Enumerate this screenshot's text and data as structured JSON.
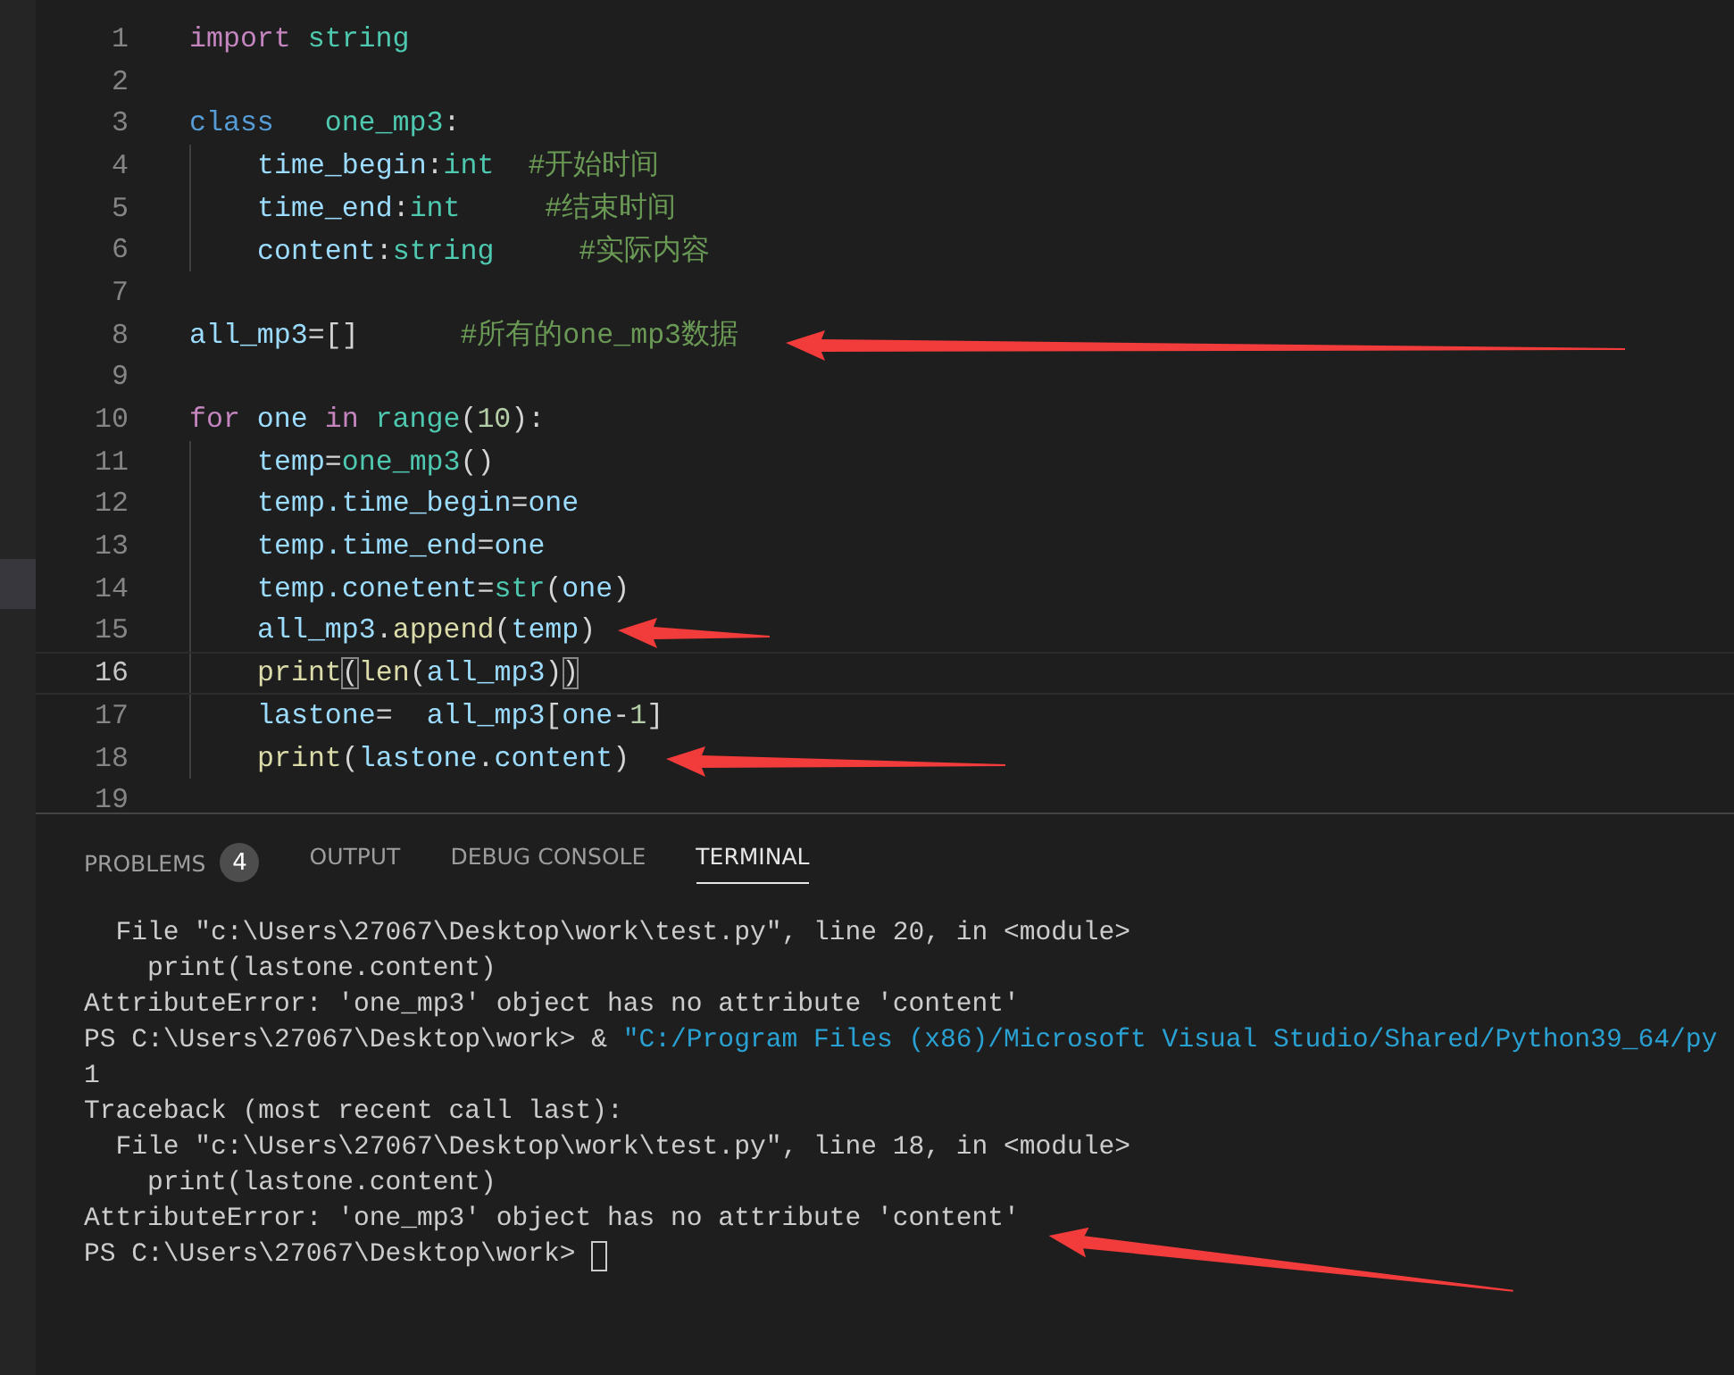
{
  "editor": {
    "lines": [
      {
        "number": "1",
        "current": false,
        "indented": false,
        "tokens": [
          {
            "kind": "keyword",
            "text": "import"
          },
          {
            "kind": "type",
            "text": " string"
          }
        ]
      },
      {
        "number": "2",
        "current": false,
        "indented": false
      },
      {
        "number": "3",
        "current": false,
        "indented": false,
        "tokens": [
          {
            "kind": "storage",
            "text": "class"
          },
          {
            "kind": "type",
            "text": "   one_mp3"
          },
          {
            "kind": "plain",
            "text": ":"
          }
        ]
      },
      {
        "number": "4",
        "current": false,
        "indented": true,
        "tokens": [
          {
            "kind": "variable",
            "text": "time_begin"
          },
          {
            "kind": "plain",
            "text": ":"
          },
          {
            "kind": "type",
            "text": "int"
          },
          {
            "kind": "comment",
            "text": "  #开始时间"
          }
        ]
      },
      {
        "number": "5",
        "current": false,
        "indented": true,
        "tokens": [
          {
            "kind": "variable",
            "text": "time_end"
          },
          {
            "kind": "plain",
            "text": ":"
          },
          {
            "kind": "type",
            "text": "int"
          },
          {
            "kind": "comment",
            "text": "     #结束时间"
          }
        ]
      },
      {
        "number": "6",
        "current": false,
        "indented": true,
        "tokens": [
          {
            "kind": "variable",
            "text": "content"
          },
          {
            "kind": "plain",
            "text": ":"
          },
          {
            "kind": "type",
            "text": "string"
          },
          {
            "kind": "comment",
            "text": "     #实际内容"
          }
        ]
      },
      {
        "number": "7",
        "current": false,
        "indented": false
      },
      {
        "number": "8",
        "current": false,
        "indented": false,
        "arrow": {
          "kind": "long"
        },
        "tokens": [
          {
            "kind": "variable",
            "text": "all_mp3"
          },
          {
            "kind": "plain",
            "text": "=[]"
          },
          {
            "kind": "comment",
            "text": "      #所有的one_mp3数据"
          }
        ]
      },
      {
        "number": "9",
        "current": false,
        "indented": false
      },
      {
        "number": "10",
        "current": false,
        "indented": false,
        "tokens": [
          {
            "kind": "keyword",
            "text": "for"
          },
          {
            "kind": "variable",
            "text": " one"
          },
          {
            "kind": "keyword",
            "text": " in"
          },
          {
            "kind": "type",
            "text": " range"
          },
          {
            "kind": "plain",
            "text": "("
          },
          {
            "kind": "number",
            "text": "10"
          },
          {
            "kind": "plain",
            "text": "):"
          }
        ]
      },
      {
        "number": "11",
        "current": false,
        "indented": true,
        "tokens": [
          {
            "kind": "variable",
            "text": "temp"
          },
          {
            "kind": "plain",
            "text": "="
          },
          {
            "kind": "type",
            "text": "one_mp3"
          },
          {
            "kind": "plain",
            "text": "()"
          }
        ]
      },
      {
        "number": "12",
        "current": false,
        "indented": true,
        "tokens": [
          {
            "kind": "variable",
            "text": "temp.time_begin"
          },
          {
            "kind": "plain",
            "text": "="
          },
          {
            "kind": "variable",
            "text": "one"
          }
        ]
      },
      {
        "number": "13",
        "current": false,
        "indented": true,
        "tokens": [
          {
            "kind": "variable",
            "text": "temp.time_end"
          },
          {
            "kind": "plain",
            "text": "="
          },
          {
            "kind": "variable",
            "text": "one"
          }
        ]
      },
      {
        "number": "14",
        "current": false,
        "indented": true,
        "tokens": [
          {
            "kind": "variable",
            "text": "temp.conetent"
          },
          {
            "kind": "plain",
            "text": "="
          },
          {
            "kind": "type",
            "text": "str"
          },
          {
            "kind": "plain",
            "text": "("
          },
          {
            "kind": "variable",
            "text": "one"
          },
          {
            "kind": "plain",
            "text": ")"
          }
        ]
      },
      {
        "number": "15",
        "current": false,
        "indented": true,
        "arrow": {
          "kind": "short"
        },
        "tokens": [
          {
            "kind": "variable",
            "text": "all_mp3"
          },
          {
            "kind": "plain",
            "text": "."
          },
          {
            "kind": "function",
            "text": "append"
          },
          {
            "kind": "plain",
            "text": "("
          },
          {
            "kind": "variable",
            "text": "temp"
          },
          {
            "kind": "plain",
            "text": ")"
          }
        ]
      },
      {
        "number": "16",
        "current": true,
        "indented": true,
        "tokens": [
          {
            "kind": "function",
            "text": "print"
          },
          {
            "kind": "bracket-match",
            "text": "("
          },
          {
            "kind": "function",
            "text": "len"
          },
          {
            "kind": "plain",
            "text": "("
          },
          {
            "kind": "variable",
            "text": "all_mp3"
          },
          {
            "kind": "plain",
            "text": ")"
          },
          {
            "kind": "bracket-match",
            "text": ")"
          }
        ]
      },
      {
        "number": "17",
        "current": false,
        "indented": true,
        "tokens": [
          {
            "kind": "variable",
            "text": "lastone"
          },
          {
            "kind": "plain",
            "text": "=  "
          },
          {
            "kind": "variable",
            "text": "all_mp3"
          },
          {
            "kind": "plain",
            "text": "["
          },
          {
            "kind": "variable",
            "text": "one"
          },
          {
            "kind": "plain",
            "text": "-"
          },
          {
            "kind": "number",
            "text": "1"
          },
          {
            "kind": "plain",
            "text": "]"
          }
        ]
      },
      {
        "number": "18",
        "current": false,
        "indented": true,
        "arrow": {
          "kind": "medium"
        },
        "tokens": [
          {
            "kind": "function",
            "text": "print"
          },
          {
            "kind": "plain",
            "text": "("
          },
          {
            "kind": "variable",
            "text": "lastone"
          },
          {
            "kind": "plain",
            "text": "."
          },
          {
            "kind": "variable",
            "text": "content"
          },
          {
            "kind": "plain",
            "text": ")"
          }
        ]
      },
      {
        "number": "19",
        "current": false,
        "indented": false
      }
    ]
  },
  "panel": {
    "tabs": [
      {
        "label": "PROBLEMS",
        "badge": "4",
        "selected": false
      },
      {
        "label": "OUTPUT",
        "selected": false
      },
      {
        "label": "DEBUG CONSOLE",
        "selected": false
      },
      {
        "label": "TERMINAL",
        "selected": true
      }
    ],
    "terminal": {
      "lines": [
        {
          "segments": [
            {
              "kind": "text",
              "text": "  File \"c:\\Users\\27067\\Desktop\\work\\test.py\", line 20, in <module>"
            }
          ]
        },
        {
          "segments": [
            {
              "kind": "text",
              "text": "    print(lastone.content)"
            }
          ]
        },
        {
          "segments": [
            {
              "kind": "text",
              "text": "AttributeError: 'one_mp3' object has no attribute 'content'"
            }
          ]
        },
        {
          "segments": [
            {
              "kind": "text",
              "text": "PS C:\\Users\\27067\\Desktop\\work> & "
            },
            {
              "kind": "path",
              "text": "\"C:/Program Files (x86)/Microsoft Visual Studio/Shared/Python39_64/py"
            }
          ]
        },
        {
          "segments": [
            {
              "kind": "text",
              "text": "1"
            }
          ]
        },
        {
          "segments": [
            {
              "kind": "text",
              "text": "Traceback (most recent call last):"
            }
          ]
        },
        {
          "segments": [
            {
              "kind": "text",
              "text": "  File \"c:\\Users\\27067\\Desktop\\work\\test.py\", line 18, in <module>"
            }
          ]
        },
        {
          "segments": [
            {
              "kind": "text",
              "text": "    print(lastone.content)"
            }
          ]
        },
        {
          "segments": [
            {
              "kind": "text",
              "text": "AttributeError: 'one_mp3' object has no attribute 'content'"
            }
          ],
          "arrow": {
            "kind": "terminal"
          }
        },
        {
          "segments": [
            {
              "kind": "text",
              "text": "PS C:\\Users\\27067\\Desktop\\work> "
            }
          ],
          "cursor": true
        }
      ]
    }
  }
}
